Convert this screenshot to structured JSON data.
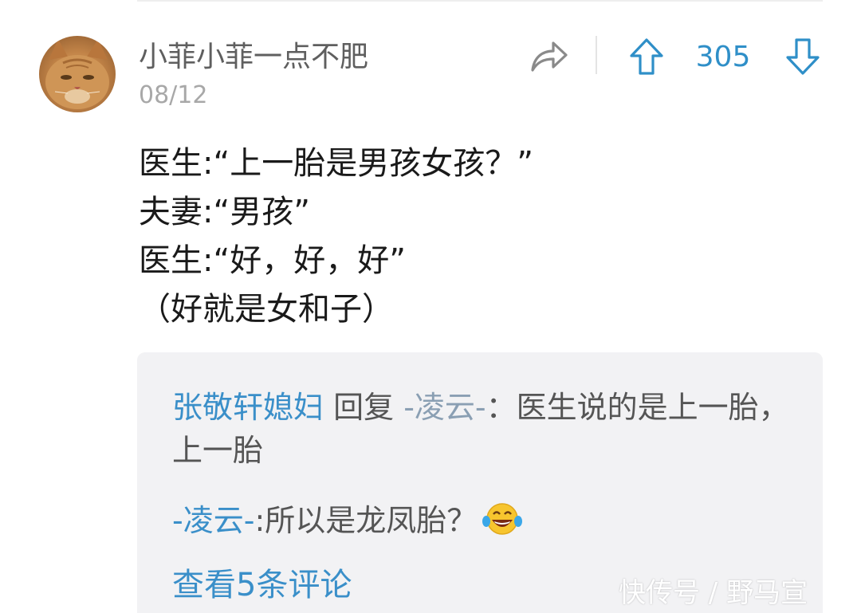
{
  "comment": {
    "username": "小菲小菲一点不肥",
    "date": "08/12",
    "vote_count": "305",
    "body_lines": [
      "医生:“上一胎是男孩女孩？”",
      "夫妻:“男孩”",
      "医生:“好，好，好”",
      "（好就是女和子）"
    ]
  },
  "icons": {
    "share": "share-arrow-icon",
    "upvote": "arrow-up-icon",
    "downvote": "arrow-down-icon",
    "emoji": "laughing-tears-emoji"
  },
  "replies": [
    {
      "author": "张敬轩媳妇",
      "verb": "回复",
      "target": "-凌云-",
      "separator": "：",
      "content": "医生说的是上一胎，上一胎"
    },
    {
      "author": "-凌云-",
      "separator": ":",
      "content": "所以是龙凤胎？"
    }
  ],
  "view_more": "查看5条评论",
  "watermark": "快传号 / 野马宣",
  "colors": {
    "accent": "#3a8fc9",
    "vote": "#2f8fc8",
    "reply_bg": "#f2f2f4",
    "body_text": "#1a1a1a",
    "muted": "#a8a8a8"
  }
}
